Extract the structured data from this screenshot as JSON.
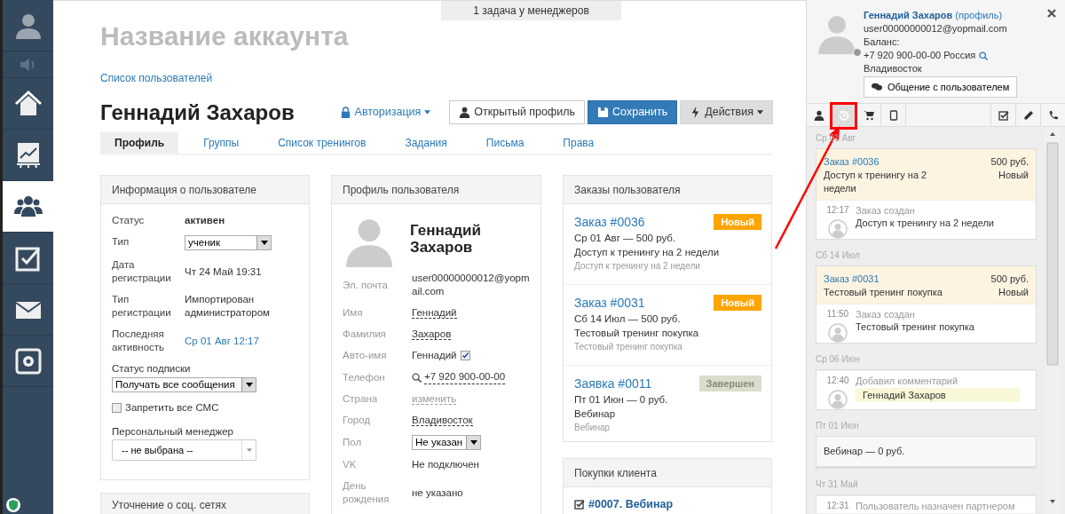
{
  "sidebar": {
    "items": [
      {
        "kind": "avatar",
        "selected": false
      },
      {
        "kind": "sound",
        "selected": false
      },
      {
        "kind": "home",
        "selected": false
      },
      {
        "kind": "chart",
        "selected": false
      },
      {
        "kind": "users",
        "selected": true
      },
      {
        "kind": "tasks",
        "selected": false
      },
      {
        "kind": "mail",
        "selected": false
      },
      {
        "kind": "safe",
        "selected": false
      }
    ]
  },
  "notice": "1 задача у менеджеров",
  "account_title": "Название аккаунта",
  "breadcrumb": "Список пользователей",
  "user_title": "Геннадий Захаров",
  "actions": [
    {
      "kind": "auth",
      "label": "Авторизация"
    },
    {
      "kind": "profile",
      "label": "Открытый профиль"
    },
    {
      "kind": "save",
      "label": "Сохранить"
    },
    {
      "kind": "menu",
      "label": "Действия"
    }
  ],
  "tabs": [
    {
      "label": "Профиль",
      "selected": true
    },
    {
      "label": "Группы",
      "selected": false
    },
    {
      "label": "Список тренингов",
      "selected": false
    },
    {
      "label": "Задания",
      "selected": false
    },
    {
      "label": "Письма",
      "selected": false
    },
    {
      "label": "Права",
      "selected": false
    }
  ],
  "user_info": {
    "title": "Информация о пользователе",
    "fields": [
      {
        "kind": "strong",
        "label": "Статус",
        "value": "активен"
      },
      {
        "kind": "select",
        "label": "Тип",
        "value": "ученик"
      },
      {
        "kind": "text",
        "label": "Дата регистрации",
        "value": "Чт 24 Май 19:31"
      },
      {
        "kind": "text",
        "label": "Тип регистрации",
        "value": "Импортирован администратором"
      },
      {
        "kind": "link",
        "label": "Последняя активность",
        "value": "Ср 01 Авг 12:17"
      }
    ],
    "subscription": {
      "label": "Статус подписки",
      "value": "Получать все сообщения"
    },
    "sms": {
      "label": "Запретить все СМС",
      "checked": false
    },
    "manager": {
      "label": "Персональный менеджер",
      "value": "-- не выбрана --"
    }
  },
  "social": {
    "title": "Уточнение о соц. сетях"
  },
  "profile": {
    "title": "Профиль пользователя",
    "name": "Геннадий Захаров",
    "fields": [
      {
        "kind": "text",
        "label": "Эл. почта",
        "value": "user00000000012@yopmail.com"
      },
      {
        "kind": "editable",
        "label": "Имя",
        "value": "Геннадий"
      },
      {
        "kind": "editable",
        "label": "Фамилия",
        "value": "Захаров"
      },
      {
        "kind": "checkbox",
        "label": "Авто-имя",
        "value": "Геннадий",
        "checked": true
      },
      {
        "kind": "phone",
        "label": "Телефон",
        "value": "+7 920 900-00-00"
      },
      {
        "kind": "muted",
        "label": "Страна",
        "value": "изменить"
      },
      {
        "kind": "editable",
        "label": "Город",
        "value": "Владивосток"
      },
      {
        "kind": "select",
        "label": "Пол",
        "value": "Не указан"
      },
      {
        "kind": "text",
        "label": "VK",
        "value": "Не подключен"
      },
      {
        "kind": "text",
        "label": "День рождения",
        "value": "не указано"
      }
    ]
  },
  "orders": {
    "title": "Заказы пользователя",
    "items": [
      {
        "number": "Заказ #0036",
        "summary": "Ср 01 Авг — 500 руб.",
        "product": "Доступ к тренингу на 2 недели",
        "note": "Доступ к тренингу на 2 недели",
        "status": "Новый",
        "color": "#ffa500"
      },
      {
        "number": "Заказ #0031",
        "summary": "Сб 14 Июл — 500 руб.",
        "product": "Тестовый тренинг покупка",
        "note": "Тестовый тренинг покупка",
        "status": "Новый",
        "color": "#ffa500"
      },
      {
        "number": "Заявка #0011",
        "summary": "Пт 01 Июн — 0 руб.",
        "product": "Вебинар",
        "note": "Вебинар",
        "status": "Завершен",
        "color": "#dcdccc"
      }
    ]
  },
  "purchases": {
    "title": "Покупки клиента",
    "items": [
      {
        "label": "#0007. Вебинар"
      }
    ]
  },
  "panel": {
    "name": "Геннадий Захаров",
    "profile_link": "(профиль)",
    "email": "user00000000012@yopmail.com",
    "balance": "Баланс:",
    "phone": "+7 920 900-00-00 Россия",
    "city": "Владивосток",
    "chat_button": "Общение с пользователем",
    "tools": [
      {
        "kind": "user",
        "selected": false,
        "highlighted": false
      },
      {
        "kind": "history",
        "selected": true,
        "highlighted": true
      },
      {
        "kind": "cart",
        "selected": false,
        "highlighted": false
      },
      {
        "kind": "tablet",
        "selected": false,
        "highlighted": false
      },
      {
        "kind": "tasks",
        "selected": false,
        "highlighted": false
      },
      {
        "kind": "edit",
        "selected": false,
        "highlighted": false
      },
      {
        "kind": "phone",
        "selected": false,
        "highlighted": false
      }
    ]
  },
  "feed": [
    {
      "date": "Ср 01 Авг",
      "entries": [
        {
          "kind": "order",
          "number": "Заказ #0036",
          "amount": "500 руб.",
          "text": "Доступ к тренингу на 2 недели",
          "status": "Новый"
        },
        {
          "kind": "event",
          "time": "12:17",
          "title": "Заказ создан",
          "text": "Доступ к тренингу на 2 недели"
        }
      ]
    },
    {
      "date": "Сб 14 Июл",
      "entries": [
        {
          "kind": "order",
          "number": "Заказ #0031",
          "amount": "500 руб.",
          "text": "Тестовый тренинг покупка",
          "status": "Новый"
        },
        {
          "kind": "event",
          "time": "11:50",
          "title": "Заказ создан",
          "text": "Тестовый тренинг покупка"
        }
      ]
    },
    {
      "date": "Ср 06 Июн",
      "entries": [
        {
          "kind": "comment",
          "time": "12:40",
          "title": "Добавил комментарий",
          "text": "Геннадий Захаров"
        }
      ]
    },
    {
      "date": "Пт 01 Июн",
      "entries": [
        {
          "kind": "plain",
          "text": "Вебинар — 0 руб."
        }
      ]
    },
    {
      "date": "Чт 31 Май",
      "entries": [
        {
          "kind": "event",
          "time": "12:31",
          "title": "Пользователь назначен партнером"
        }
      ]
    }
  ]
}
